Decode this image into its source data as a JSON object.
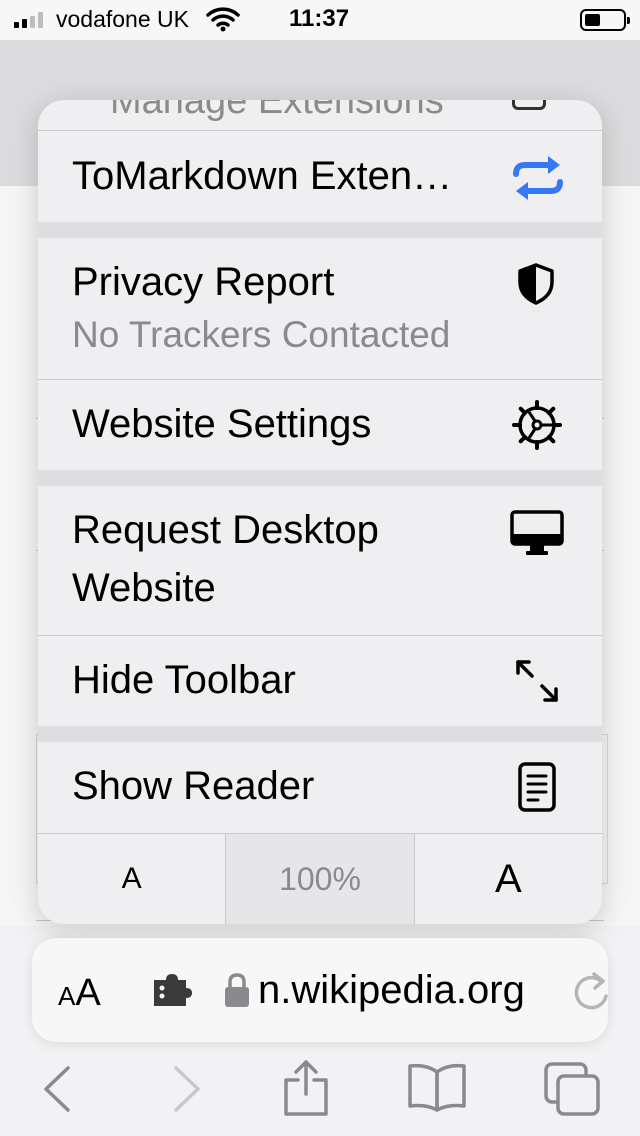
{
  "status_bar": {
    "carrier": "vodafone UK",
    "time": "11:37"
  },
  "menu": {
    "cut_off_label": "Manage Extensions",
    "items": [
      {
        "label": "ToMarkdown Exten…",
        "icon": "arrows-swap-icon"
      },
      {
        "label": "Privacy Report",
        "subtitle": "No Trackers Contacted",
        "icon": "shield-icon"
      },
      {
        "label": "Website Settings",
        "icon": "gear-icon"
      },
      {
        "label_line1": "Request Desktop",
        "label_line2": "Website",
        "icon": "desktop-icon"
      },
      {
        "label": "Hide Toolbar",
        "icon": "expand-arrows-icon"
      },
      {
        "label": "Show Reader",
        "icon": "reader-icon"
      }
    ],
    "zoom": {
      "decrease_label": "A",
      "level": "100%",
      "increase_label": "A"
    }
  },
  "address_bar": {
    "format_label_small": "A",
    "format_label_large": "A",
    "domain": "n.wikipedia.org"
  },
  "colors": {
    "accent": "#3478f6",
    "menu_background": "#efeff1",
    "secondary_text": "#8a8a8e"
  }
}
